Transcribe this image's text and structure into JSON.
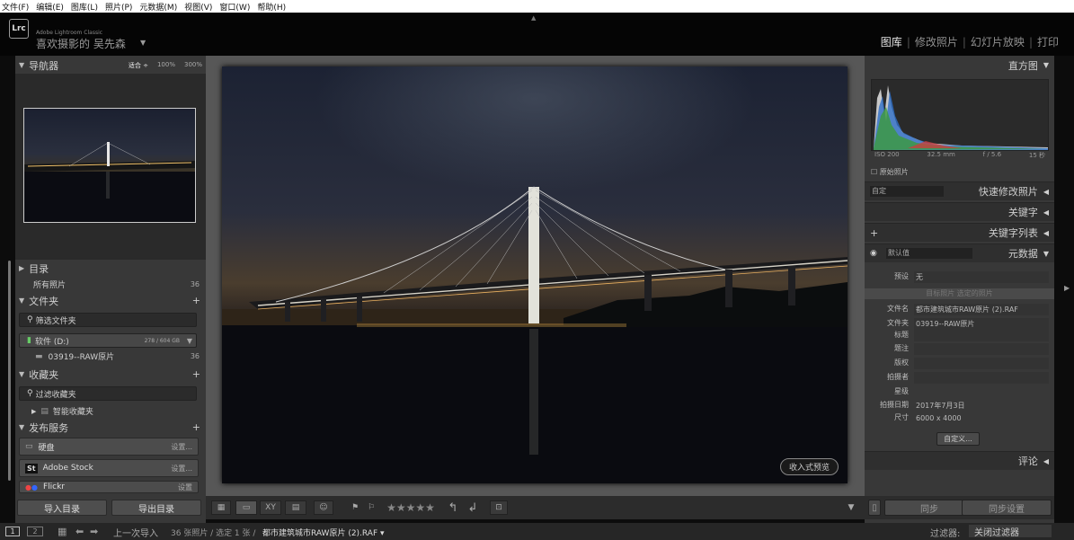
{
  "menubar": [
    "文件(F)",
    "编辑(E)",
    "图库(L)",
    "照片(P)",
    "元数据(M)",
    "视图(V)",
    "窗口(W)",
    "帮助(H)"
  ],
  "app": {
    "badge": "Lrc",
    "name": "Adobe Lightroom Classic",
    "identity": "喜欢摄影的 吴先森"
  },
  "modules": [
    "图库",
    "修改照片",
    "幻灯片放映",
    "打印"
  ],
  "navigator": {
    "title": "导航器",
    "zoom": [
      "适合 ÷",
      "100%",
      "300%"
    ]
  },
  "catalog": {
    "title": "目录",
    "all_photos": "所有照片",
    "all_count": "36"
  },
  "folders": {
    "title": "文件夹",
    "filter": "筛选文件夹",
    "volume": "软件 (D:)",
    "volume_info": "278 / 604 GB",
    "folder": "03919--RAW原片",
    "folder_count": "36"
  },
  "collections": {
    "title": "收藏夹",
    "filter": "过滤收藏夹",
    "smart": "智能收藏夹"
  },
  "publish": {
    "title": "发布服务",
    "items": [
      {
        "name": "硬盘",
        "set": "设置..."
      },
      {
        "name": "Adobe Stock",
        "set": "设置..."
      },
      {
        "name": "Flickr",
        "set": "设置"
      }
    ]
  },
  "left_buttons": {
    "import": "导入目录",
    "export": "导出目录"
  },
  "loupe": "收入式预览",
  "toolbar": {
    "stars": "★★★★★"
  },
  "right": {
    "histogram": "直方图",
    "histo_info": {
      "iso": "ISO 200",
      "focal": "32.5 mm",
      "aperture": "f / 5.6",
      "shutter": "15 秒"
    },
    "original": "原始照片",
    "quick_preset": "自定",
    "quick_develop": "快速修改照片",
    "keywords": "关键字",
    "keyword_list": "关键字列表",
    "meta_preset": "默认值",
    "metadata": "元数据",
    "preset_label": "预设",
    "preset_value": "无",
    "tabs": "目标照片    选定的照片",
    "fields": [
      {
        "label": "文件名",
        "value": "都市建筑城市RAW原片 (2).RAF"
      },
      {
        "label": "文件夹",
        "value": "03919--RAW原片"
      },
      {
        "label": "标题",
        "value": ""
      },
      {
        "label": "题注",
        "value": ""
      },
      {
        "label": "版权",
        "value": ""
      },
      {
        "label": "拍摄者",
        "value": ""
      },
      {
        "label": "星级",
        "value": ""
      },
      {
        "label": "拍摄日期",
        "value": "2017年7月3日"
      },
      {
        "label": "尺寸",
        "value": "6000 x 4000"
      }
    ],
    "custom": "自定义...",
    "comments": "评论",
    "sync": "同步",
    "sync_settings": "同步设置"
  },
  "bottombar": {
    "screen1": "1",
    "screen2": "2",
    "source": "上一次导入",
    "status": "36 张照片 / 选定 1 张 /",
    "filename": "都市建筑城市RAW原片 (2).RAF ▾",
    "filter_label": "过滤器:",
    "filter_value": "关闭过滤器"
  }
}
